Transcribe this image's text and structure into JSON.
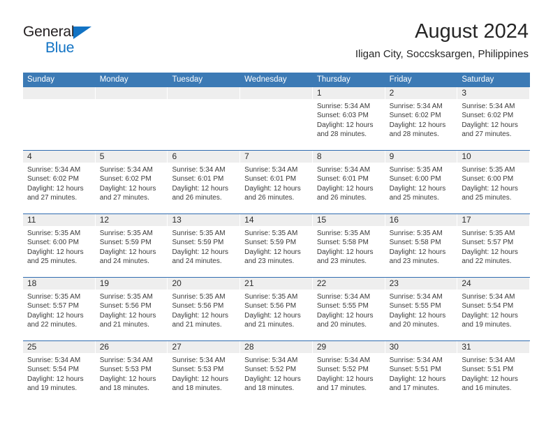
{
  "logo": {
    "word1": "General",
    "word2": "Blue",
    "triangle_color": "#1273c4",
    "word1_color": "#231f20",
    "word2_color": "#1273c4"
  },
  "header": {
    "title": "August 2024",
    "subtitle": "Iligan City, Soccsksargen, Philippines"
  },
  "theme": {
    "header_blue": "#3c7ab5",
    "rule_blue": "#2f6cb0",
    "day_band_gray": "#eeeeee",
    "text": "#2b2b2b"
  },
  "calendar": {
    "weekday_headers": [
      "Sunday",
      "Monday",
      "Tuesday",
      "Wednesday",
      "Thursday",
      "Friday",
      "Saturday"
    ],
    "weeks": [
      [
        {
          "day": "",
          "empty": true,
          "sunrise": "",
          "sunset": "",
          "daylight_line1": "",
          "daylight_line2": ""
        },
        {
          "day": "",
          "empty": true,
          "sunrise": "",
          "sunset": "",
          "daylight_line1": "",
          "daylight_line2": ""
        },
        {
          "day": "",
          "empty": true,
          "sunrise": "",
          "sunset": "",
          "daylight_line1": "",
          "daylight_line2": ""
        },
        {
          "day": "",
          "empty": true,
          "sunrise": "",
          "sunset": "",
          "daylight_line1": "",
          "daylight_line2": ""
        },
        {
          "day": "1",
          "empty": false,
          "sunrise": "Sunrise: 5:34 AM",
          "sunset": "Sunset: 6:03 PM",
          "daylight_line1": "Daylight: 12 hours",
          "daylight_line2": "and 28 minutes."
        },
        {
          "day": "2",
          "empty": false,
          "sunrise": "Sunrise: 5:34 AM",
          "sunset": "Sunset: 6:02 PM",
          "daylight_line1": "Daylight: 12 hours",
          "daylight_line2": "and 28 minutes."
        },
        {
          "day": "3",
          "empty": false,
          "sunrise": "Sunrise: 5:34 AM",
          "sunset": "Sunset: 6:02 PM",
          "daylight_line1": "Daylight: 12 hours",
          "daylight_line2": "and 27 minutes."
        }
      ],
      [
        {
          "day": "4",
          "empty": false,
          "sunrise": "Sunrise: 5:34 AM",
          "sunset": "Sunset: 6:02 PM",
          "daylight_line1": "Daylight: 12 hours",
          "daylight_line2": "and 27 minutes."
        },
        {
          "day": "5",
          "empty": false,
          "sunrise": "Sunrise: 5:34 AM",
          "sunset": "Sunset: 6:02 PM",
          "daylight_line1": "Daylight: 12 hours",
          "daylight_line2": "and 27 minutes."
        },
        {
          "day": "6",
          "empty": false,
          "sunrise": "Sunrise: 5:34 AM",
          "sunset": "Sunset: 6:01 PM",
          "daylight_line1": "Daylight: 12 hours",
          "daylight_line2": "and 26 minutes."
        },
        {
          "day": "7",
          "empty": false,
          "sunrise": "Sunrise: 5:34 AM",
          "sunset": "Sunset: 6:01 PM",
          "daylight_line1": "Daylight: 12 hours",
          "daylight_line2": "and 26 minutes."
        },
        {
          "day": "8",
          "empty": false,
          "sunrise": "Sunrise: 5:34 AM",
          "sunset": "Sunset: 6:01 PM",
          "daylight_line1": "Daylight: 12 hours",
          "daylight_line2": "and 26 minutes."
        },
        {
          "day": "9",
          "empty": false,
          "sunrise": "Sunrise: 5:35 AM",
          "sunset": "Sunset: 6:00 PM",
          "daylight_line1": "Daylight: 12 hours",
          "daylight_line2": "and 25 minutes."
        },
        {
          "day": "10",
          "empty": false,
          "sunrise": "Sunrise: 5:35 AM",
          "sunset": "Sunset: 6:00 PM",
          "daylight_line1": "Daylight: 12 hours",
          "daylight_line2": "and 25 minutes."
        }
      ],
      [
        {
          "day": "11",
          "empty": false,
          "sunrise": "Sunrise: 5:35 AM",
          "sunset": "Sunset: 6:00 PM",
          "daylight_line1": "Daylight: 12 hours",
          "daylight_line2": "and 25 minutes."
        },
        {
          "day": "12",
          "empty": false,
          "sunrise": "Sunrise: 5:35 AM",
          "sunset": "Sunset: 5:59 PM",
          "daylight_line1": "Daylight: 12 hours",
          "daylight_line2": "and 24 minutes."
        },
        {
          "day": "13",
          "empty": false,
          "sunrise": "Sunrise: 5:35 AM",
          "sunset": "Sunset: 5:59 PM",
          "daylight_line1": "Daylight: 12 hours",
          "daylight_line2": "and 24 minutes."
        },
        {
          "day": "14",
          "empty": false,
          "sunrise": "Sunrise: 5:35 AM",
          "sunset": "Sunset: 5:59 PM",
          "daylight_line1": "Daylight: 12 hours",
          "daylight_line2": "and 23 minutes."
        },
        {
          "day": "15",
          "empty": false,
          "sunrise": "Sunrise: 5:35 AM",
          "sunset": "Sunset: 5:58 PM",
          "daylight_line1": "Daylight: 12 hours",
          "daylight_line2": "and 23 minutes."
        },
        {
          "day": "16",
          "empty": false,
          "sunrise": "Sunrise: 5:35 AM",
          "sunset": "Sunset: 5:58 PM",
          "daylight_line1": "Daylight: 12 hours",
          "daylight_line2": "and 23 minutes."
        },
        {
          "day": "17",
          "empty": false,
          "sunrise": "Sunrise: 5:35 AM",
          "sunset": "Sunset: 5:57 PM",
          "daylight_line1": "Daylight: 12 hours",
          "daylight_line2": "and 22 minutes."
        }
      ],
      [
        {
          "day": "18",
          "empty": false,
          "sunrise": "Sunrise: 5:35 AM",
          "sunset": "Sunset: 5:57 PM",
          "daylight_line1": "Daylight: 12 hours",
          "daylight_line2": "and 22 minutes."
        },
        {
          "day": "19",
          "empty": false,
          "sunrise": "Sunrise: 5:35 AM",
          "sunset": "Sunset: 5:56 PM",
          "daylight_line1": "Daylight: 12 hours",
          "daylight_line2": "and 21 minutes."
        },
        {
          "day": "20",
          "empty": false,
          "sunrise": "Sunrise: 5:35 AM",
          "sunset": "Sunset: 5:56 PM",
          "daylight_line1": "Daylight: 12 hours",
          "daylight_line2": "and 21 minutes."
        },
        {
          "day": "21",
          "empty": false,
          "sunrise": "Sunrise: 5:35 AM",
          "sunset": "Sunset: 5:56 PM",
          "daylight_line1": "Daylight: 12 hours",
          "daylight_line2": "and 21 minutes."
        },
        {
          "day": "22",
          "empty": false,
          "sunrise": "Sunrise: 5:34 AM",
          "sunset": "Sunset: 5:55 PM",
          "daylight_line1": "Daylight: 12 hours",
          "daylight_line2": "and 20 minutes."
        },
        {
          "day": "23",
          "empty": false,
          "sunrise": "Sunrise: 5:34 AM",
          "sunset": "Sunset: 5:55 PM",
          "daylight_line1": "Daylight: 12 hours",
          "daylight_line2": "and 20 minutes."
        },
        {
          "day": "24",
          "empty": false,
          "sunrise": "Sunrise: 5:34 AM",
          "sunset": "Sunset: 5:54 PM",
          "daylight_line1": "Daylight: 12 hours",
          "daylight_line2": "and 19 minutes."
        }
      ],
      [
        {
          "day": "25",
          "empty": false,
          "sunrise": "Sunrise: 5:34 AM",
          "sunset": "Sunset: 5:54 PM",
          "daylight_line1": "Daylight: 12 hours",
          "daylight_line2": "and 19 minutes."
        },
        {
          "day": "26",
          "empty": false,
          "sunrise": "Sunrise: 5:34 AM",
          "sunset": "Sunset: 5:53 PM",
          "daylight_line1": "Daylight: 12 hours",
          "daylight_line2": "and 18 minutes."
        },
        {
          "day": "27",
          "empty": false,
          "sunrise": "Sunrise: 5:34 AM",
          "sunset": "Sunset: 5:53 PM",
          "daylight_line1": "Daylight: 12 hours",
          "daylight_line2": "and 18 minutes."
        },
        {
          "day": "28",
          "empty": false,
          "sunrise": "Sunrise: 5:34 AM",
          "sunset": "Sunset: 5:52 PM",
          "daylight_line1": "Daylight: 12 hours",
          "daylight_line2": "and 18 minutes."
        },
        {
          "day": "29",
          "empty": false,
          "sunrise": "Sunrise: 5:34 AM",
          "sunset": "Sunset: 5:52 PM",
          "daylight_line1": "Daylight: 12 hours",
          "daylight_line2": "and 17 minutes."
        },
        {
          "day": "30",
          "empty": false,
          "sunrise": "Sunrise: 5:34 AM",
          "sunset": "Sunset: 5:51 PM",
          "daylight_line1": "Daylight: 12 hours",
          "daylight_line2": "and 17 minutes."
        },
        {
          "day": "31",
          "empty": false,
          "sunrise": "Sunrise: 5:34 AM",
          "sunset": "Sunset: 5:51 PM",
          "daylight_line1": "Daylight: 12 hours",
          "daylight_line2": "and 16 minutes."
        }
      ]
    ]
  }
}
